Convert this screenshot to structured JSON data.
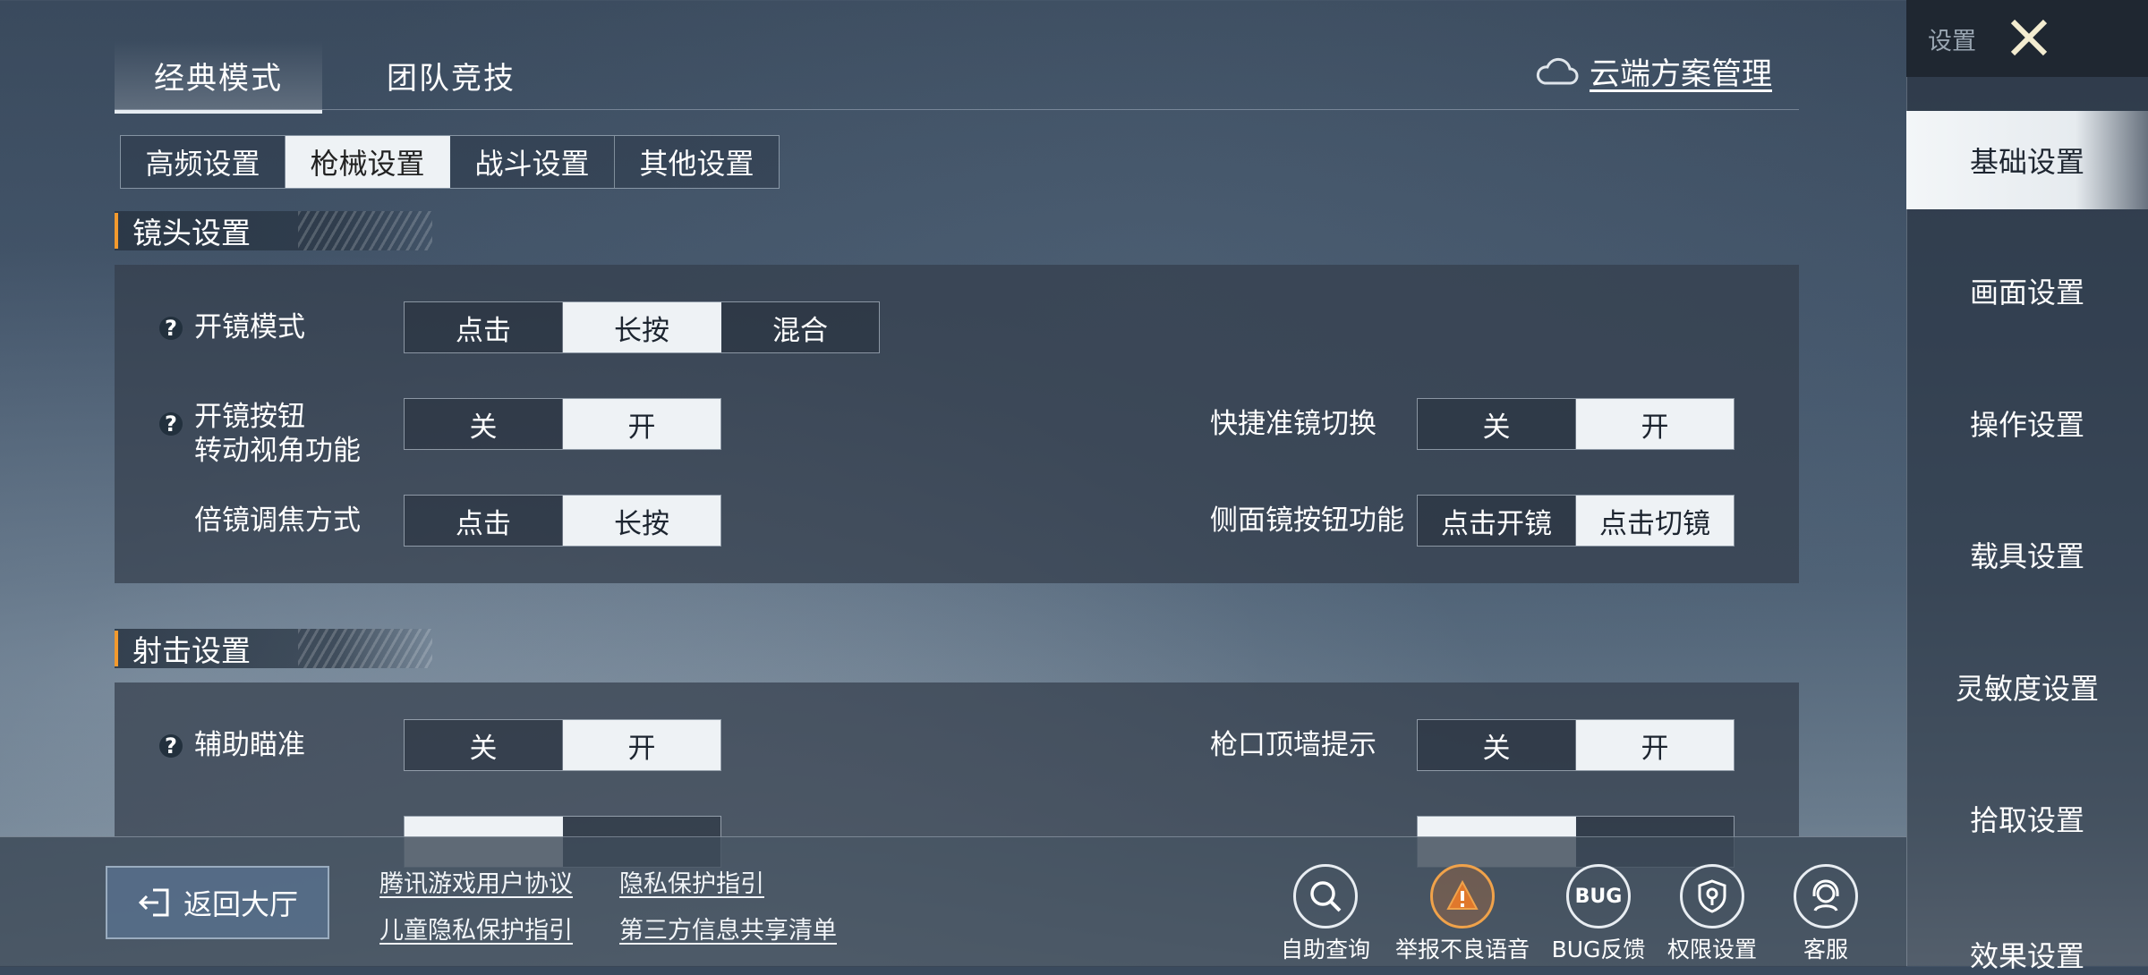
{
  "mode_tabs": [
    "经典模式",
    "团队竞技"
  ],
  "cloud_label": "云端方案管理",
  "sub_tabs": [
    "高频设置",
    "枪械设置",
    "战斗设置",
    "其他设置"
  ],
  "lens": {
    "title": "镜头设置",
    "scope_mode": {
      "label": "开镜模式",
      "options": [
        "点击",
        "长按",
        "混合"
      ],
      "selected": "长按"
    },
    "scope_btn": {
      "label1": "开镜按钮",
      "label2": "转动视角功能",
      "options": [
        "关",
        "开"
      ],
      "selected": "开"
    },
    "zoom": {
      "label": "倍镜调焦方式",
      "options": [
        "点击",
        "长按"
      ],
      "selected": "长按"
    },
    "quick_switch": {
      "label": "快捷准镜切换",
      "options": [
        "关",
        "开"
      ],
      "selected": "开"
    },
    "side_scope": {
      "label": "侧面镜按钮功能",
      "options": [
        "点击开镜",
        "点击切镜"
      ],
      "selected": "点击切镜"
    }
  },
  "shoot": {
    "title": "射击设置",
    "aim_assist": {
      "label": "辅助瞄准",
      "options": [
        "关",
        "开"
      ],
      "selected": "开"
    },
    "muzzle": {
      "label": "枪口顶墙提示",
      "options": [
        "关",
        "开"
      ],
      "selected": "开"
    }
  },
  "bottom": {
    "back_label": "返回大厅",
    "links": [
      "腾讯游戏用户协议",
      "隐私保护指引",
      "儿童隐私保护指引",
      "第三方信息共享清单"
    ],
    "icons": [
      {
        "label": "自助查询",
        "icon": "search-icon"
      },
      {
        "label": "举报不良语音",
        "icon": "report-icon"
      },
      {
        "label": "BUG反馈",
        "icon": "bug-icon"
      },
      {
        "label": "权限设置",
        "icon": "permission-icon"
      },
      {
        "label": "客服",
        "icon": "support-icon"
      }
    ],
    "bug_text": "BUG"
  },
  "sidebar": {
    "title": "设置",
    "items": [
      "基础设置",
      "画面设置",
      "操作设置",
      "载具设置",
      "灵敏度设置",
      "拾取设置",
      "效果设置"
    ]
  }
}
